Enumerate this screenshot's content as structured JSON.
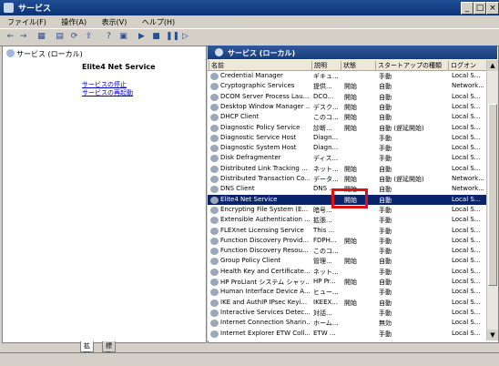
{
  "window": {
    "title": "サービス",
    "min_label": "_",
    "max_label": "□",
    "close_label": "×"
  },
  "menu": [
    "ファイル(F)",
    "操作(A)",
    "表示(V)",
    "ヘルプ(H)"
  ],
  "toolbar": [
    "←",
    "→",
    "▦",
    "▤",
    "⟳",
    "⇪",
    "?",
    "▣",
    "▶",
    "■",
    "❚❚",
    "▷"
  ],
  "tree": {
    "root": "サービス (ローカル)"
  },
  "header": {
    "title": "サービス (ローカル)"
  },
  "description": {
    "service_name": "Elite4 Net Service",
    "link_stop": "サービスの停止",
    "link_restart": "サービスの再起動"
  },
  "columns": [
    "名前",
    "説明",
    "状態",
    "スタートアップの種類",
    "ログオン"
  ],
  "rows": [
    [
      "Credential Manager",
      "ギキュ...",
      "",
      "手動",
      "Local S..."
    ],
    [
      "Cryptographic Services",
      "提供...",
      "開始",
      "自動",
      "Network..."
    ],
    [
      "DCOM Server Process Lau...",
      "DCO...",
      "開始",
      "自動",
      "Local S..."
    ],
    [
      "Desktop Window Manager ...",
      "デスク...",
      "開始",
      "自動",
      "Local S..."
    ],
    [
      "DHCP Client",
      "このコ...",
      "開始",
      "自動",
      "Local S..."
    ],
    [
      "Diagnostic Policy Service",
      "診断...",
      "開始",
      "自動 (遅延開始)",
      "Local S..."
    ],
    [
      "Diagnostic Service Host",
      "Diagn...",
      "",
      "手動",
      "Local S..."
    ],
    [
      "Diagnostic System Host",
      "Diagn...",
      "",
      "手動",
      "Local S..."
    ],
    [
      "Disk Defragmenter",
      "ディス...",
      "",
      "手動",
      "Local S..."
    ],
    [
      "Distributed Link Tracking ...",
      "ネット...",
      "開始",
      "自動",
      "Local S..."
    ],
    [
      "Distributed Transaction Co...",
      "データ...",
      "開始",
      "自動 (遅延開始)",
      "Network..."
    ],
    [
      "DNS Client",
      "DNS ...",
      "開始",
      "自動",
      "Network..."
    ],
    [
      "Elite4 Net Service",
      "",
      "開始",
      "自動",
      "Local S..."
    ],
    [
      "Encrypting File System (E...",
      "暗号...",
      "",
      "手動",
      "Local S..."
    ],
    [
      "Extensible Authentication ...",
      "拡張...",
      "",
      "手動",
      "Local S..."
    ],
    [
      "FLEXnet Licensing Service",
      "This ...",
      "",
      "手動",
      "Local S..."
    ],
    [
      "Function Discovery Provid...",
      "FDPH...",
      "開始",
      "手動",
      "Local S..."
    ],
    [
      "Function Discovery Resou...",
      "このコ...",
      "",
      "手動",
      "Local S..."
    ],
    [
      "Group Policy Client",
      "管理...",
      "開始",
      "自動",
      "Local S..."
    ],
    [
      "Health Key and Certificate...",
      "ネット...",
      "",
      "手動",
      "Local S..."
    ],
    [
      "HP ProLiant システム シャッ...",
      "HP Pr...",
      "開始",
      "自動",
      "Local S..."
    ],
    [
      "Human Interface Device A...",
      "ヒュー...",
      "",
      "手動",
      "Local S..."
    ],
    [
      "IKE and AuthIP IPsec Keyi...",
      "IKEEX...",
      "開始",
      "自動",
      "Local S..."
    ],
    [
      "Interactive Services Detec...",
      "対話...",
      "",
      "手動",
      "Local S..."
    ],
    [
      "Internet Connection Sharin...",
      "ホーム...",
      "",
      "無効",
      "Local S..."
    ],
    [
      "Internet Explorer ETW Coll...",
      "ETW ...",
      "",
      "手動",
      "Local S..."
    ]
  ],
  "selected_index": 12,
  "tabs": [
    "拡張",
    "標準"
  ],
  "colors": {
    "selection": "#0a246a",
    "highlight_box": "#e01010"
  }
}
